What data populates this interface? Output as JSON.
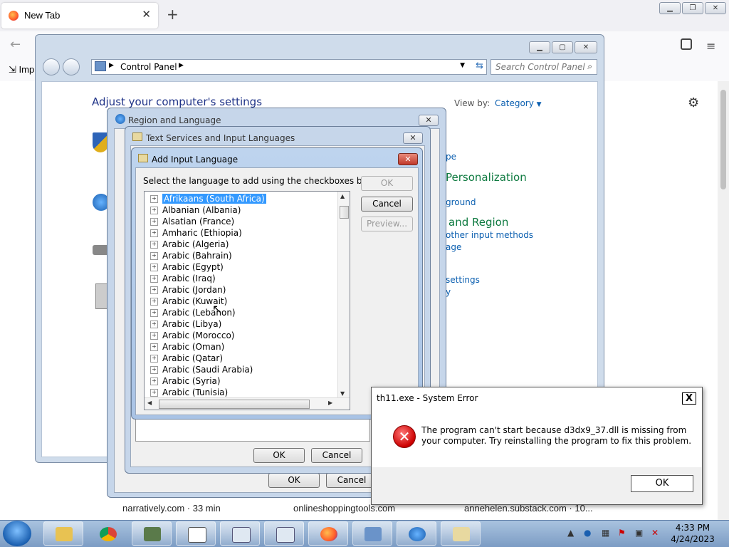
{
  "browser": {
    "tab_title": "New Tab",
    "tab_close": "✕",
    "new_tab": "+",
    "import_label": "Imp",
    "news": [
      {
        "label": "narratively.com · 33 min"
      },
      {
        "label": "onlineshoppingtools.com"
      },
      {
        "label": "annehelen.substack.com · 10..."
      }
    ]
  },
  "control_panel": {
    "breadcrumb": "Control Panel",
    "search_placeholder": "Search Control Panel",
    "heading": "Adjust your computer's settings",
    "view_by_label": "View by:",
    "view_by_value": "Category",
    "partial_links": {
      "pe": "pe",
      "personalization": "Personalization",
      "ground": "ground",
      "and_region": "and Region",
      "other_input": "other input methods",
      "age": "age",
      "settings": "settings",
      "y": "y"
    }
  },
  "region_dialog": {
    "title": "Region and Language",
    "ok": "OK",
    "cancel": "Cancel"
  },
  "text_services_dialog": {
    "title": "Text Services and Input Languages",
    "ok": "OK",
    "cancel": "Cancel"
  },
  "add_input_dialog": {
    "title": "Add Input Language",
    "instruction": "Select the language to add using the checkboxes below.",
    "ok": "OK",
    "cancel": "Cancel",
    "preview": "Preview...",
    "languages": [
      "Afrikaans (South Africa)",
      "Albanian (Albania)",
      "Alsatian (France)",
      "Amharic (Ethiopia)",
      "Arabic (Algeria)",
      "Arabic (Bahrain)",
      "Arabic (Egypt)",
      "Arabic (Iraq)",
      "Arabic (Jordan)",
      "Arabic (Kuwait)",
      "Arabic (Lebanon)",
      "Arabic (Libya)",
      "Arabic (Morocco)",
      "Arabic (Oman)",
      "Arabic (Qatar)",
      "Arabic (Saudi Arabia)",
      "Arabic (Syria)",
      "Arabic (Tunisia)"
    ],
    "selected_index": 0
  },
  "error_dialog": {
    "title": "th11.exe - System Error",
    "close": "X",
    "message": "The program can't start because d3dx9_37.dll is missing from your computer. Try reinstalling the program to fix this problem.",
    "ok": "OK"
  },
  "taskbar": {
    "time": "4:33 PM",
    "date": "4/24/2023"
  },
  "colors": {
    "selection": "#3399ff",
    "link": "#0b5fb0",
    "heading": "#1e3287",
    "error_red": "#cc0000"
  }
}
